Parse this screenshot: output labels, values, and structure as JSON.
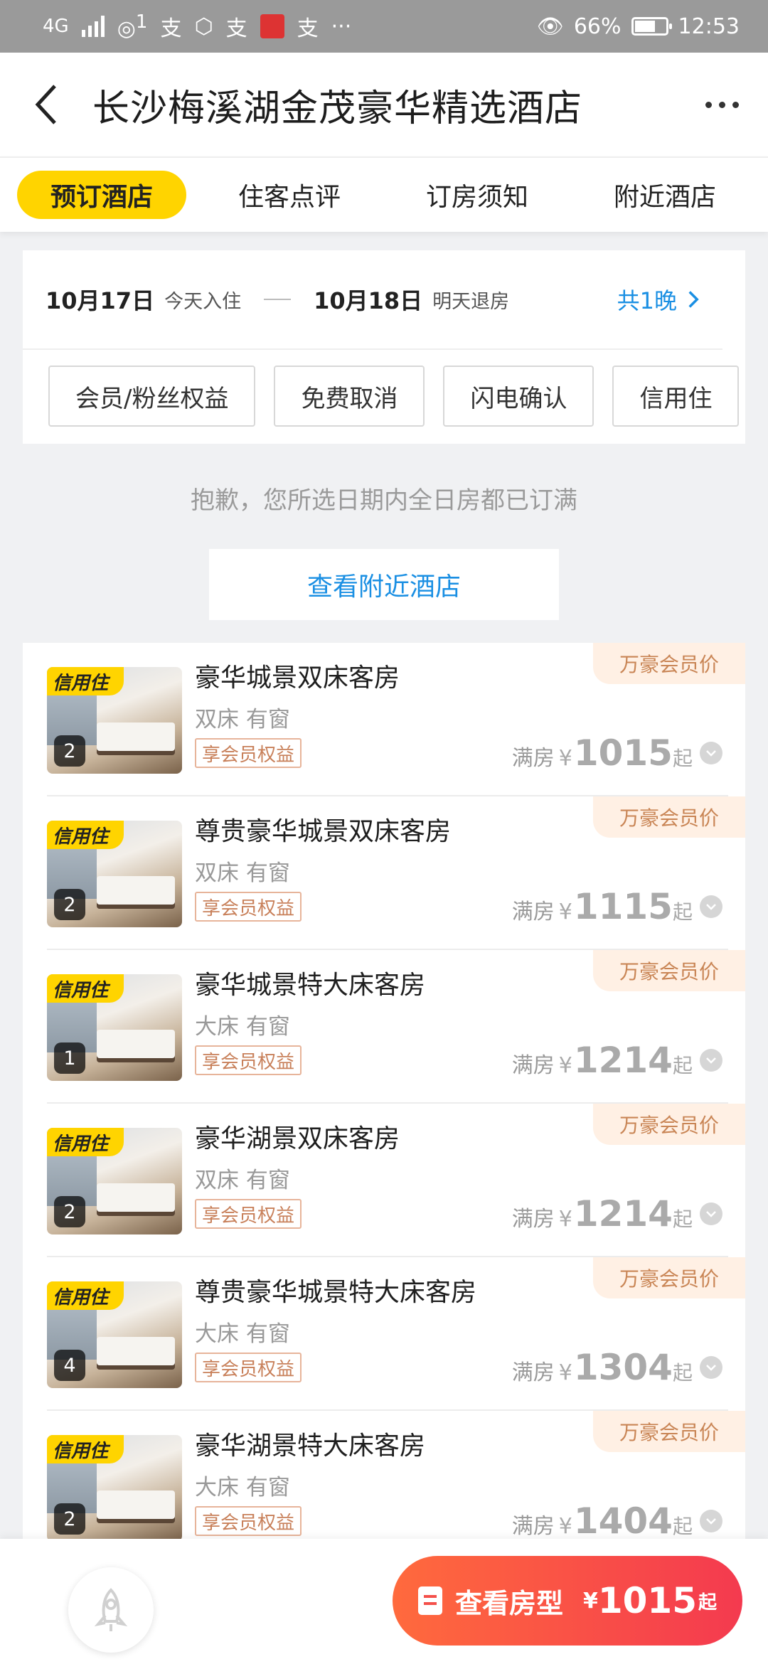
{
  "status_bar": {
    "network": "4G",
    "hotspot_count": "1",
    "battery": "66%",
    "battery_level": 0.66,
    "time": "12:53",
    "app_icons": [
      "支",
      "支",
      "支"
    ]
  },
  "header": {
    "title": "长沙梅溪湖金茂豪华精选酒店"
  },
  "tabs": [
    {
      "label": "预订酒店",
      "active": true
    },
    {
      "label": "住客点评",
      "active": false
    },
    {
      "label": "订房须知",
      "active": false
    },
    {
      "label": "附近酒店",
      "active": false
    }
  ],
  "dates": {
    "checkin_date": "10月17日",
    "checkin_note": "今天入住",
    "checkout_date": "10月18日",
    "checkout_note": "明天退房",
    "nights": "共1晚"
  },
  "filters": [
    "会员/粉丝权益",
    "免费取消",
    "闪电确认",
    "信用住"
  ],
  "notice": {
    "sorry": "抱歉，您所选日期内全日房都已订满",
    "nearby_button": "查看附近酒店"
  },
  "rooms": [
    {
      "name": "豪华城景双床客房",
      "attrs": "双床 有窗",
      "benefit": "享会员权益",
      "tag": "万豪会员价",
      "badge": "信用住",
      "count": "2",
      "status": "满房",
      "currency": "¥",
      "price": "1015",
      "suffix": "起"
    },
    {
      "name": "尊贵豪华城景双床客房",
      "attrs": "双床 有窗",
      "benefit": "享会员权益",
      "tag": "万豪会员价",
      "badge": "信用住",
      "count": "2",
      "status": "满房",
      "currency": "¥",
      "price": "1115",
      "suffix": "起"
    },
    {
      "name": "豪华城景特大床客房",
      "attrs": "大床 有窗",
      "benefit": "享会员权益",
      "tag": "万豪会员价",
      "badge": "信用住",
      "count": "1",
      "status": "满房",
      "currency": "¥",
      "price": "1214",
      "suffix": "起"
    },
    {
      "name": "豪华湖景双床客房",
      "attrs": "双床 有窗",
      "benefit": "享会员权益",
      "tag": "万豪会员价",
      "badge": "信用住",
      "count": "2",
      "status": "满房",
      "currency": "¥",
      "price": "1214",
      "suffix": "起"
    },
    {
      "name": "尊贵豪华城景特大床客房",
      "attrs": "大床 有窗",
      "benefit": "享会员权益",
      "tag": "万豪会员价",
      "badge": "信用住",
      "count": "4",
      "status": "满房",
      "currency": "¥",
      "price": "1304",
      "suffix": "起"
    },
    {
      "name": "豪华湖景特大床客房",
      "attrs": "大床 有窗",
      "benefit": "享会员权益",
      "tag": "万豪会员价",
      "badge": "信用住",
      "count": "2",
      "status": "满房",
      "currency": "¥",
      "price": "1404",
      "suffix": "起"
    }
  ],
  "bottom": {
    "cta_label": "查看房型",
    "currency": "¥",
    "price": "1015",
    "suffix": "起"
  },
  "colors": {
    "accent_yellow": "#ffd400",
    "link_blue": "#1a8fe3",
    "cta_start": "#ff6a3d",
    "cta_end": "#f43a4f",
    "member_tag_bg": "#fff0e4",
    "member_tag_text": "#c98555"
  }
}
